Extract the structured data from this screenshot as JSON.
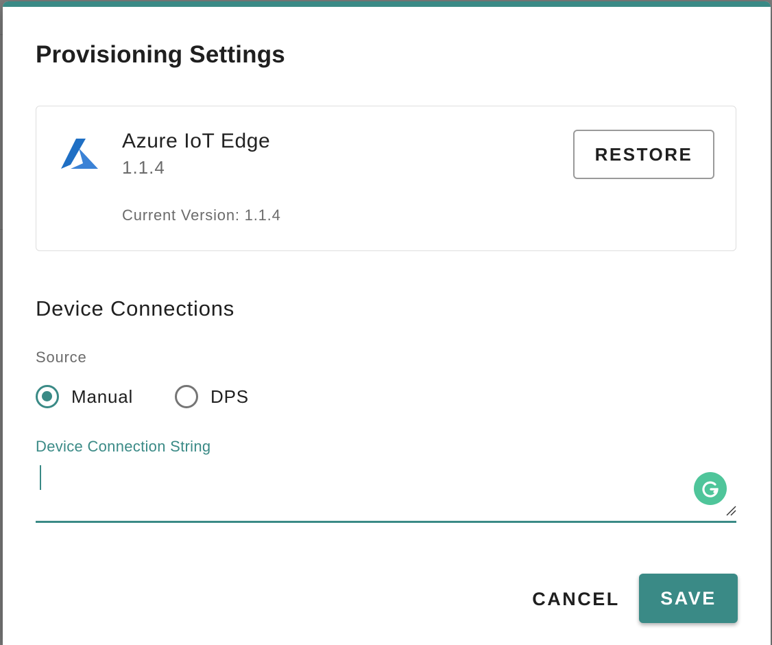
{
  "dialog": {
    "title": "Provisioning Settings",
    "accent_color": "#3a8a86"
  },
  "product": {
    "logo_icon": "azure-logo-icon",
    "name": "Azure IoT Edge",
    "version": "1.1.4",
    "current_version_text": "Current Version: 1.1.4",
    "restore_label": "RESTORE"
  },
  "device_connections": {
    "section_title": "Device Connections",
    "source_label": "Source",
    "options": [
      {
        "label": "Manual",
        "checked": true
      },
      {
        "label": "DPS",
        "checked": false
      }
    ],
    "connection_string_label": "Device Connection String",
    "connection_string_value": "",
    "grammarly_icon": "grammarly-icon",
    "grammarly_color": "#4fc59a"
  },
  "actions": {
    "cancel_label": "CANCEL",
    "save_label": "SAVE"
  }
}
